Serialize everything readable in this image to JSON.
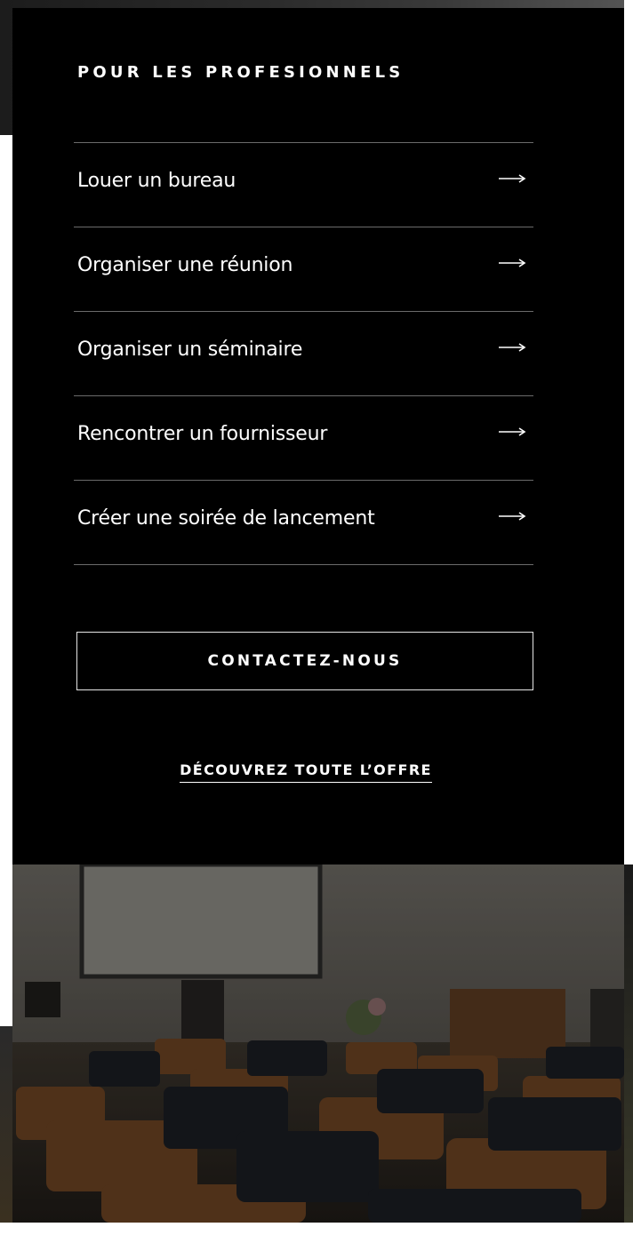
{
  "section": {
    "title": "POUR LES PROFESIONNELS"
  },
  "menu": {
    "items": [
      {
        "label": "Louer un bureau",
        "icon": "arrow-right-icon"
      },
      {
        "label": "Organiser une réunion",
        "icon": "arrow-right-icon"
      },
      {
        "label": "Organiser un séminaire",
        "icon": "arrow-right-icon"
      },
      {
        "label": "Rencontrer un fournisseur",
        "icon": "arrow-right-icon"
      },
      {
        "label": "Créer une soirée de lancement",
        "icon": "arrow-right-icon"
      }
    ]
  },
  "cta": {
    "contact_label": "CONTACTEZ-NOUS",
    "discover_label": "DÉCOUVREZ TOUTE L’OFFRE"
  },
  "colors": {
    "card_background": "#000000",
    "divider": "#6b6b6b",
    "text": "#ffffff",
    "button_border": "#e6e6e6"
  }
}
